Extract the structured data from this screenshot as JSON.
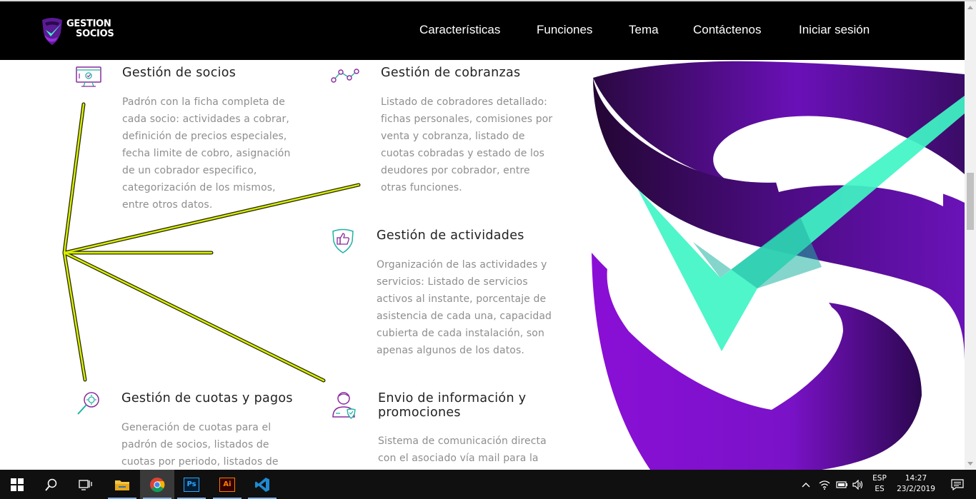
{
  "brand": {
    "line1": "GESTION",
    "line2": "SOCIOS"
  },
  "nav": {
    "items": [
      {
        "label": "Características"
      },
      {
        "label": "Funciones"
      },
      {
        "label": "Tema"
      },
      {
        "label": "Contáctenos"
      },
      {
        "label": "Iniciar sesión"
      }
    ]
  },
  "features": {
    "socios": {
      "title": "Gestión de socios",
      "lines": [
        "Padrón con la ficha completa de",
        "cada socio: actividades a cobrar,",
        "definición de precios especiales,",
        "fecha limite de cobro, asignación",
        "de un cobrador especifico,",
        "categorización de los mismos,",
        "entre otros datos."
      ]
    },
    "cobranzas": {
      "title": "Gestión de cobranzas",
      "lines": [
        "Listado de cobradores detallado:",
        "fichas personales, comisiones por",
        "venta y cobranza, listado de",
        "cuotas cobradas y estado de los",
        "deudores por cobrador, entre",
        "otras funciones."
      ]
    },
    "actividades": {
      "title": "Gestión de actividades",
      "lines": [
        "Organización de las actividades y",
        "servicios: Listado de servicios",
        "activos al instante, porcentaje de",
        "asistencia de cada una, capacidad",
        "cubierta de cada instalación, son",
        "apenas algunos de los datos."
      ]
    },
    "cuotas": {
      "title": "Gestión de cuotas y pagos",
      "lines": [
        "Generación de cuotas para el",
        "padrón de socios, listados de",
        "cuotas por periodo, listados de"
      ]
    },
    "envio": {
      "title_line1": "Envio de información y",
      "title_line2": "promociones",
      "lines": [
        "Sistema de comunicación directa",
        "con el asociado vía mail para la"
      ]
    }
  },
  "colors": {
    "accent_purple": "#8a0fd6",
    "accent_teal": "#3ff5c4",
    "icon_purple": "#8a2a9f",
    "icon_teal": "#1fb3a3",
    "annotation": "#d8f000"
  },
  "taskbar": {
    "apps": [
      {
        "icon": "windows-start-icon"
      },
      {
        "icon": "search-icon"
      },
      {
        "icon": "task-view-icon"
      },
      {
        "icon": "file-explorer-icon"
      },
      {
        "icon": "chrome-icon"
      },
      {
        "icon": "photoshop-icon",
        "label": "Ps"
      },
      {
        "icon": "illustrator-icon",
        "label": "Ai"
      },
      {
        "icon": "vscode-icon"
      }
    ],
    "language_top": "ESP",
    "language_bottom": "ES",
    "time": "14:27",
    "date": "23/2/2019"
  }
}
